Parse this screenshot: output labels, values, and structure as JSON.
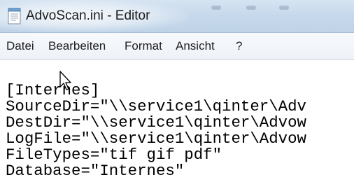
{
  "window": {
    "title": "AdvoScan.ini - Editor",
    "icon": "notepad-icon"
  },
  "menu": {
    "items": [
      {
        "label": "Datei"
      },
      {
        "label": "Bearbeiten"
      },
      {
        "label": "Format"
      },
      {
        "label": "Ansicht"
      },
      {
        "label": "?"
      }
    ]
  },
  "editor": {
    "lines": [
      "[Internes]",
      "SourceDir=\"\\\\service1\\qinter\\Adv",
      "DestDir=\"\\\\service1\\qinter\\Advow",
      "LogFile=\"\\\\service1\\qinter\\Advow",
      "FileTypes=\"tif gif pdf\"",
      "Database=\"Internes\""
    ]
  },
  "colors": {
    "titlebar": "#c7d9ec",
    "menubar": "#f2f5fa",
    "text": "#000000"
  },
  "pointer": "arrow-cursor-icon"
}
